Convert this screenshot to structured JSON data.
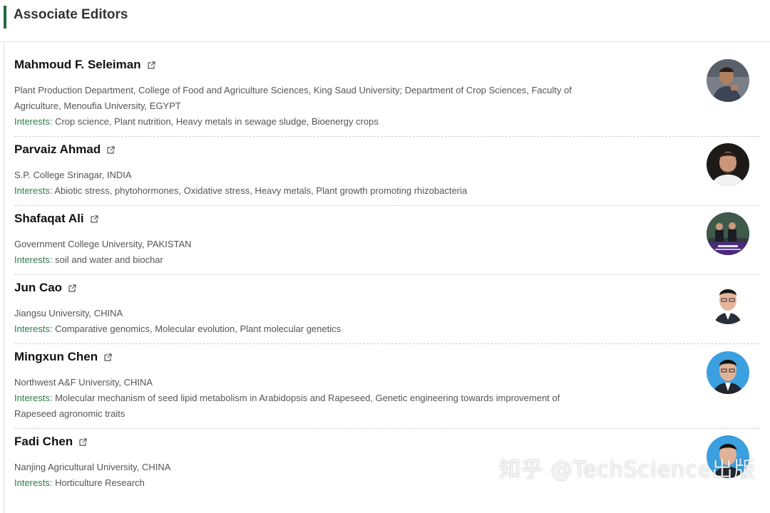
{
  "section": {
    "title": "Associate Editors"
  },
  "editors": [
    {
      "name": "Mahmoud F. Seleiman",
      "affiliation_lines": [
        "Plant Production Department, College of Food and Agriculture Sciences, King Saud University; Department of Crop Sciences, Faculty of",
        "Agriculture, Menoufia University, EGYPT"
      ],
      "interests_label": "Interests:",
      "interests_lines": [
        "Crop science, Plant nutrition, Heavy metals in sewage sludge, Bioenergy crops"
      ]
    },
    {
      "name": "Parvaiz Ahmad",
      "affiliation_lines": [
        "S.P. College Srinagar, INDIA"
      ],
      "interests_label": "Interests:",
      "interests_lines": [
        "Abiotic stress, phytohormones, Oxidative stress, Heavy metals, Plant growth promoting rhizobacteria"
      ]
    },
    {
      "name": "Shafaqat Ali",
      "affiliation_lines": [
        "Government College University, PAKISTAN"
      ],
      "interests_label": "Interests:",
      "interests_lines": [
        "soil and water and biochar"
      ]
    },
    {
      "name": "Jun Cao",
      "affiliation_lines": [
        "Jiangsu University, CHINA"
      ],
      "interests_label": "Interests:",
      "interests_lines": [
        "Comparative genomics, Molecular evolution, Plant molecular genetics"
      ]
    },
    {
      "name": "Mingxun Chen",
      "affiliation_lines": [
        "Northwest A&F University, CHINA"
      ],
      "interests_label": "Interests:",
      "interests_lines": [
        "Molecular mechanism of seed lipid metabolism in Arabidopsis and Rapeseed, Genetic engineering towards improvement of",
        "Rapeseed agronomic traits"
      ]
    },
    {
      "name": "Fadi Chen",
      "affiliation_lines": [
        "Nanjing Agricultural University, CHINA"
      ],
      "interests_label": "Interests:",
      "interests_lines": [
        "Horticulture Research"
      ]
    }
  ],
  "watermark": {
    "text": "知乎 @TechScience出版"
  },
  "colors": {
    "accent": "#1f6b3d",
    "interests_label": "#2c7a4b"
  }
}
